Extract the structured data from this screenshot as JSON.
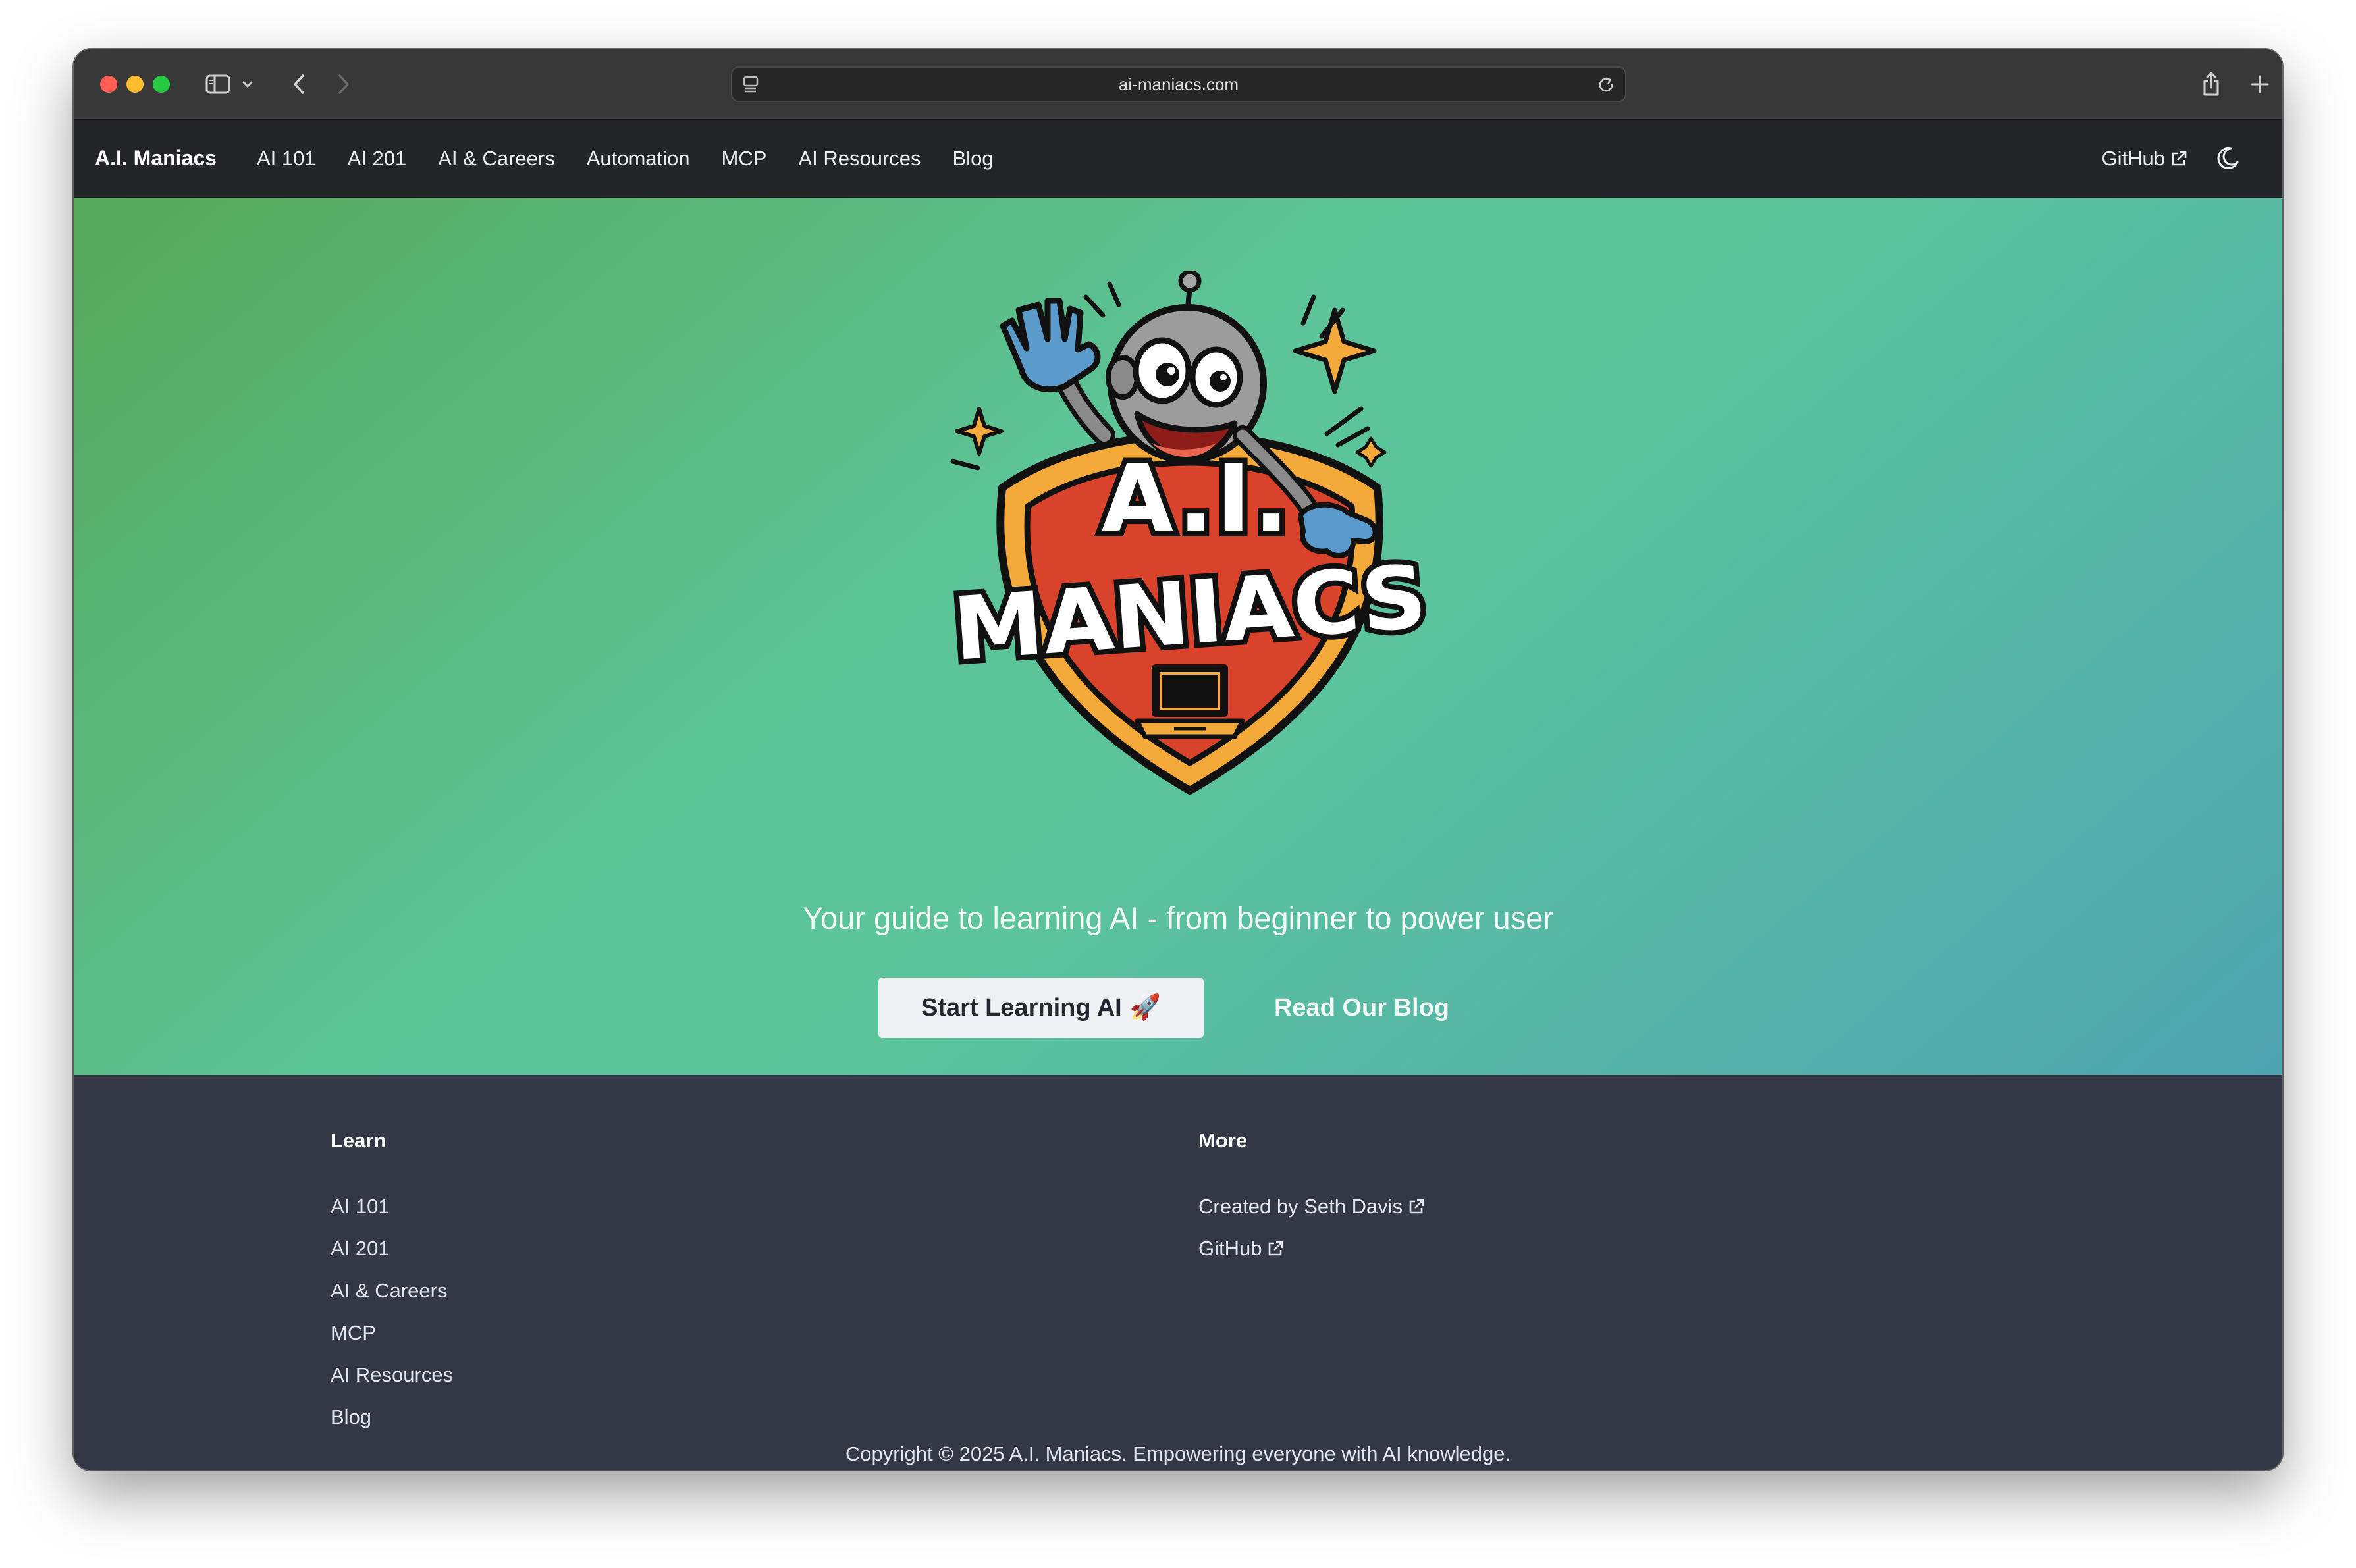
{
  "browser": {
    "url": "ai-maniacs.com"
  },
  "nav": {
    "brand": "A.I. Maniacs",
    "links": [
      "AI 101",
      "AI 201",
      "AI & Careers",
      "Automation",
      "MCP",
      "AI Resources",
      "Blog"
    ],
    "github": "GitHub"
  },
  "hero": {
    "logo_text": [
      "A.I.",
      "MANIACS"
    ],
    "tagline": "Your guide to learning AI - from beginner to power user",
    "primary_button": "Start Learning AI",
    "primary_button_emoji": "🚀",
    "secondary_link": "Read Our Blog"
  },
  "footer": {
    "learn": {
      "heading": "Learn",
      "links": [
        "AI 101",
        "AI 201",
        "AI & Careers",
        "MCP",
        "AI Resources",
        "Blog"
      ]
    },
    "more": {
      "heading": "More",
      "links": [
        "Created by Seth Davis",
        "GitHub"
      ]
    },
    "copyright": "Copyright © 2025 A.I. Maniacs. Empowering everyone with AI knowledge."
  },
  "colors": {
    "hero_gradient_start": "#56a85a",
    "hero_gradient_mid": "#5cc497",
    "hero_gradient_end": "#4fa4b2",
    "nav_bg": "#242528",
    "footer_bg": "#333746",
    "shield_red": "#d9432c",
    "shield_orange": "#f4a93b"
  },
  "icons": {
    "sidebar": "sidebar-icon",
    "back": "chevron-left-icon",
    "forward": "chevron-right-icon",
    "reload": "reload-icon",
    "share": "share-icon",
    "new_tab": "plus-icon",
    "tabs": "tabs-overview-icon",
    "external": "external-link-icon",
    "theme": "moon-icon"
  }
}
